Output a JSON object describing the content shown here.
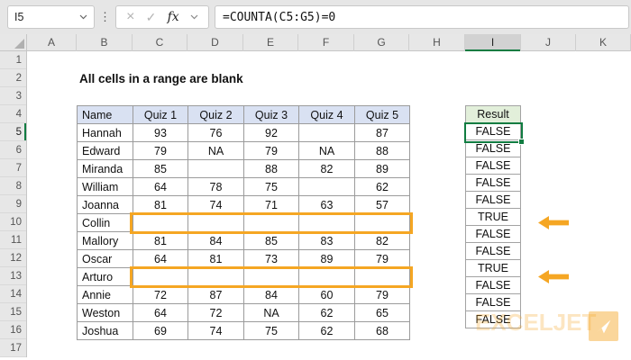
{
  "colors": {
    "excel_green": "#107C41",
    "accent_orange": "#F5A623",
    "table_header_blue": "#D9E1F2",
    "result_header_green": "#E2EFDA"
  },
  "formula_bar": {
    "name_box": "I5",
    "fx_label": "fx",
    "formula": "=COUNTA(C5:G5)=0"
  },
  "grid": {
    "column_headers": [
      "A",
      "B",
      "C",
      "D",
      "E",
      "F",
      "G",
      "H",
      "I",
      "J",
      "K"
    ],
    "selected_column": "I",
    "row_headers": [
      "1",
      "2",
      "3",
      "4",
      "5",
      "6",
      "7",
      "8",
      "9",
      "10",
      "11",
      "12",
      "13",
      "14",
      "15",
      "16",
      "17"
    ],
    "selected_row": "5"
  },
  "title": "All cells in a range are blank",
  "table": {
    "headers": [
      "Name",
      "Quiz 1",
      "Quiz 2",
      "Quiz 3",
      "Quiz 4",
      "Quiz 5"
    ],
    "rows": [
      {
        "name": "Hannah",
        "scores": [
          "93",
          "76",
          "92",
          "",
          "87"
        ],
        "highlighted": false
      },
      {
        "name": "Edward",
        "scores": [
          "79",
          "NA",
          "79",
          "NA",
          "88"
        ],
        "highlighted": false
      },
      {
        "name": "Miranda",
        "scores": [
          "85",
          "",
          "88",
          "82",
          "89"
        ],
        "highlighted": false
      },
      {
        "name": "William",
        "scores": [
          "64",
          "78",
          "75",
          "",
          "62"
        ],
        "highlighted": false
      },
      {
        "name": "Joanna",
        "scores": [
          "81",
          "74",
          "71",
          "63",
          "57"
        ],
        "highlighted": false
      },
      {
        "name": "Collin",
        "scores": [
          "",
          "",
          "",
          "",
          ""
        ],
        "highlighted": true
      },
      {
        "name": "Mallory",
        "scores": [
          "81",
          "84",
          "85",
          "83",
          "82"
        ],
        "highlighted": false
      },
      {
        "name": "Oscar",
        "scores": [
          "64",
          "81",
          "73",
          "89",
          "79"
        ],
        "highlighted": false
      },
      {
        "name": "Arturo",
        "scores": [
          "",
          "",
          "",
          "",
          ""
        ],
        "highlighted": true
      },
      {
        "name": "Annie",
        "scores": [
          "72",
          "87",
          "84",
          "60",
          "79"
        ],
        "highlighted": false
      },
      {
        "name": "Weston",
        "scores": [
          "64",
          "72",
          "NA",
          "62",
          "65"
        ],
        "highlighted": false
      },
      {
        "name": "Joshua",
        "scores": [
          "69",
          "74",
          "75",
          "62",
          "68"
        ],
        "highlighted": false
      }
    ]
  },
  "result": {
    "header": "Result",
    "values": [
      "FALSE",
      "FALSE",
      "FALSE",
      "FALSE",
      "FALSE",
      "TRUE",
      "FALSE",
      "FALSE",
      "TRUE",
      "FALSE",
      "FALSE",
      "FALSE"
    ],
    "active_index": 0
  },
  "watermark": {
    "text": "EXCELJET"
  }
}
